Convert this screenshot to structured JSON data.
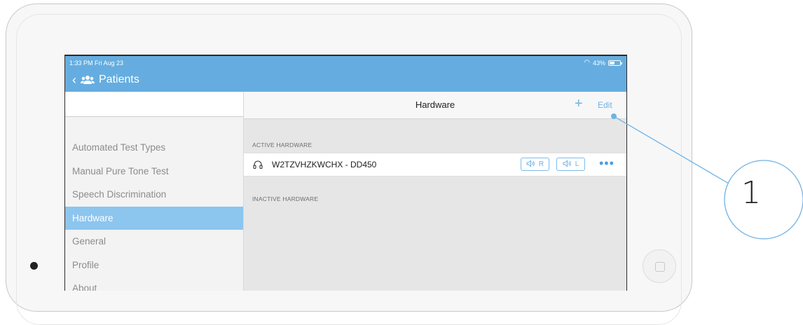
{
  "status_bar": {
    "time": "1:33 PM  Fri Aug 23",
    "battery": "43%"
  },
  "nav": {
    "back_label": "Patients"
  },
  "sidebar": {
    "items": [
      {
        "label": "Automated Test Types"
      },
      {
        "label": "Manual Pure Tone Test"
      },
      {
        "label": "Speech Discrimination"
      },
      {
        "label": "Hardware",
        "active": true
      },
      {
        "label": "General"
      },
      {
        "label": "Profile"
      },
      {
        "label": "About"
      }
    ]
  },
  "main": {
    "title": "Hardware",
    "add_label": "+",
    "edit_label": "Edit",
    "active_section": "ACTIVE HARDWARE",
    "inactive_section": "INACTIVE HARDWARE",
    "hardware": [
      {
        "name": "W2TZVHZKWCHX - DD450",
        "right_label": "R",
        "left_label": "L",
        "more_label": "•••"
      }
    ]
  },
  "callout": {
    "number": "1"
  },
  "colors": {
    "accent": "#65ade0",
    "selection": "#8cc5ee",
    "link": "#6fb2e4"
  }
}
